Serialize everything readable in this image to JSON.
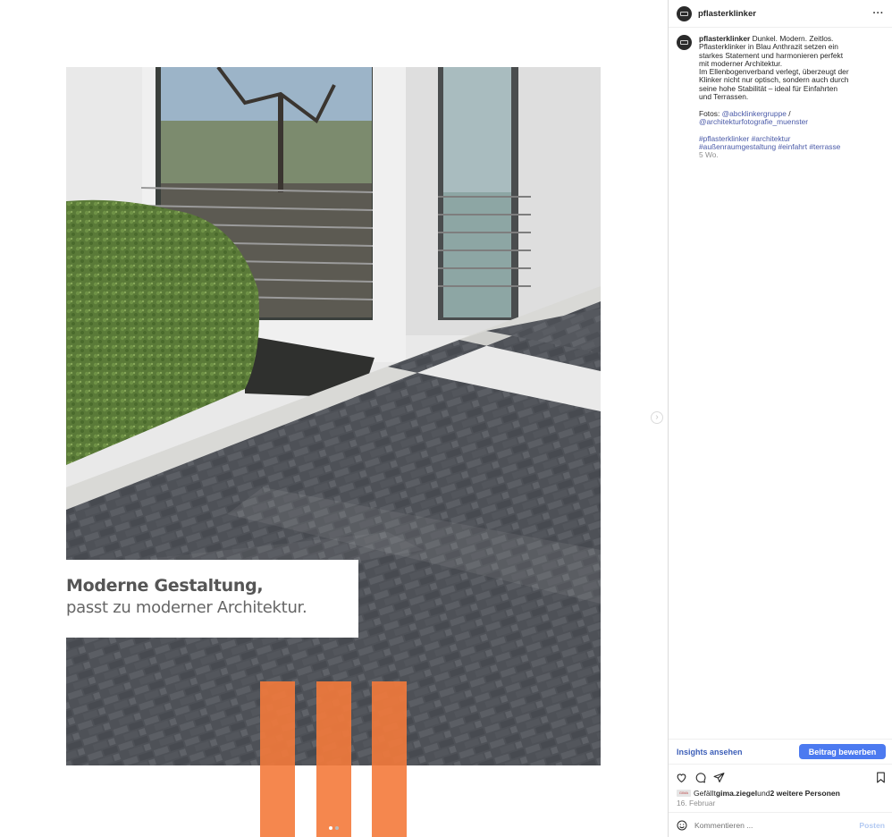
{
  "post": {
    "username": "pflasterklinker",
    "more_icon": "more-horizontal-icon",
    "caption_lines": [
      "Dunkel. Modern. Zeitlos.",
      "Pflasterklinker in Blau Anthrazit setzen ein",
      "starkes Statement und harmonieren perfekt",
      "mit moderner Architektur.",
      "Im Ellenbogenverband verlegt, überzeugt der",
      "Klinker nicht nur optisch, sondern auch durch",
      "seine hohe Stabilität – ideal für Einfahrten",
      "und Terrassen."
    ],
    "fotos_label": "Fotos: ",
    "mention_1": "@abcklinkergruppe",
    "mention_sep": " /",
    "mention_2": "@architekturfotografie_muenster",
    "hashtags_line1": "#pflasterklinker #architektur",
    "hashtags_line2": "#außenraumgestaltung #einfahrt #terrasse",
    "age": "5 Wo."
  },
  "image_overlay": {
    "headline": "Moderne Gestaltung,",
    "subline": "passt zu moderner Architektur.",
    "accent_color": "#f47a3b"
  },
  "insights": {
    "link_label": "Insights ansehen",
    "promote_label": "Beitrag bewerben"
  },
  "actions": {
    "icons": [
      "heart-icon",
      "comment-icon",
      "share-icon",
      "bookmark-icon"
    ]
  },
  "likes": {
    "prefix": "Gefällt ",
    "user": "gima.ziegel",
    "middle": " und ",
    "others": "2 weitere Personen",
    "avatar_text": "GIMA"
  },
  "date": "16. Februar",
  "comment": {
    "placeholder": "Kommentieren ...",
    "post_label": "Posten"
  },
  "carousel": {
    "slide_count": 2,
    "active_index": 0
  }
}
